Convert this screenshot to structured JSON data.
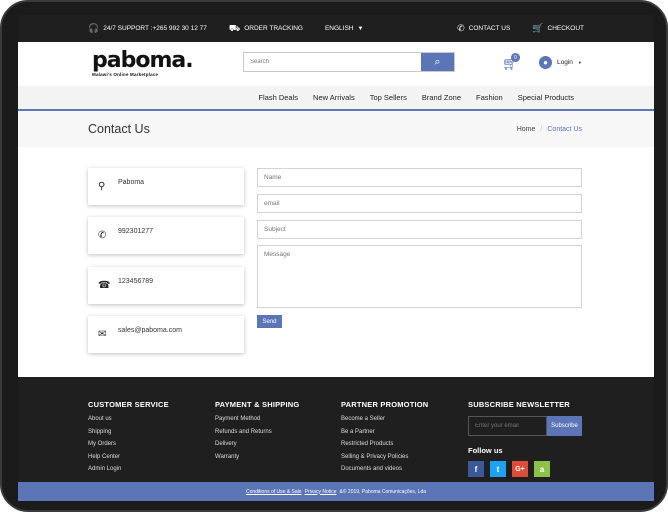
{
  "topbar": {
    "support": "24/7 SUPPORT :+265 992 30 12 77",
    "tracking": "ORDER TRACKING",
    "language": "ENGLISH",
    "contact": "CONTACT US",
    "checkout": "CHECKOUT"
  },
  "header": {
    "brand": "paboma.",
    "tagline": "Malawi's Online Marketplace",
    "search_placeholder": "Search",
    "cart_count": "0",
    "login": "Login"
  },
  "nav": [
    "Flash Deals",
    "New Arrivals",
    "Top Sellers",
    "Brand Zone",
    "Fashion",
    "Special Products"
  ],
  "page": {
    "title": "Contact Us",
    "breadcrumb_home": "Home",
    "breadcrumb_sep": "/",
    "breadcrumb_current": "Contact Us"
  },
  "contact": {
    "address": "Paboma",
    "phone": "992301277",
    "fax": "123456789",
    "email": "sales@paboma.com"
  },
  "form": {
    "name_ph": "Name",
    "email_ph": "email",
    "subject_ph": "Subject",
    "message_ph": "Message",
    "send": "Send"
  },
  "footer": {
    "customer_service": {
      "title": "CUSTOMER SERVICE",
      "links": [
        "About us",
        "Shipping",
        "My Orders",
        "Help Center",
        "Admin Login"
      ]
    },
    "payment": {
      "title": "PAYMENT & SHIPPING",
      "links": [
        "Payment Method",
        "Refunds and Returns",
        "Delivery",
        "Warranty"
      ]
    },
    "partner": {
      "title": "PARTNER PROMOTION",
      "links": [
        "Become a Seller",
        "Be a Partner",
        "Restricted Products",
        "Selling & Privacy Policies",
        "Documents and videos"
      ]
    },
    "newsletter": {
      "title": "SUBSCRIBE NEWSLETTER",
      "placeholder": "Enter your email",
      "button": "Subscribe",
      "follow": "Follow us"
    },
    "social": {
      "facebook": "f",
      "twitter": "t",
      "google": "G+",
      "android": "a"
    },
    "bottom": {
      "conditions": "Conditions of Use & Sale",
      "privacy": "Privacy Notice",
      "copyright": "&© 2019, Paboma Comunicações, Lda"
    }
  },
  "colors": {
    "accent": "#5b75b7",
    "dark": "#1f1f1f",
    "facebook": "#3b5998",
    "twitter": "#1da1f2",
    "google": "#dd4b39",
    "android": "#8bc34a"
  }
}
